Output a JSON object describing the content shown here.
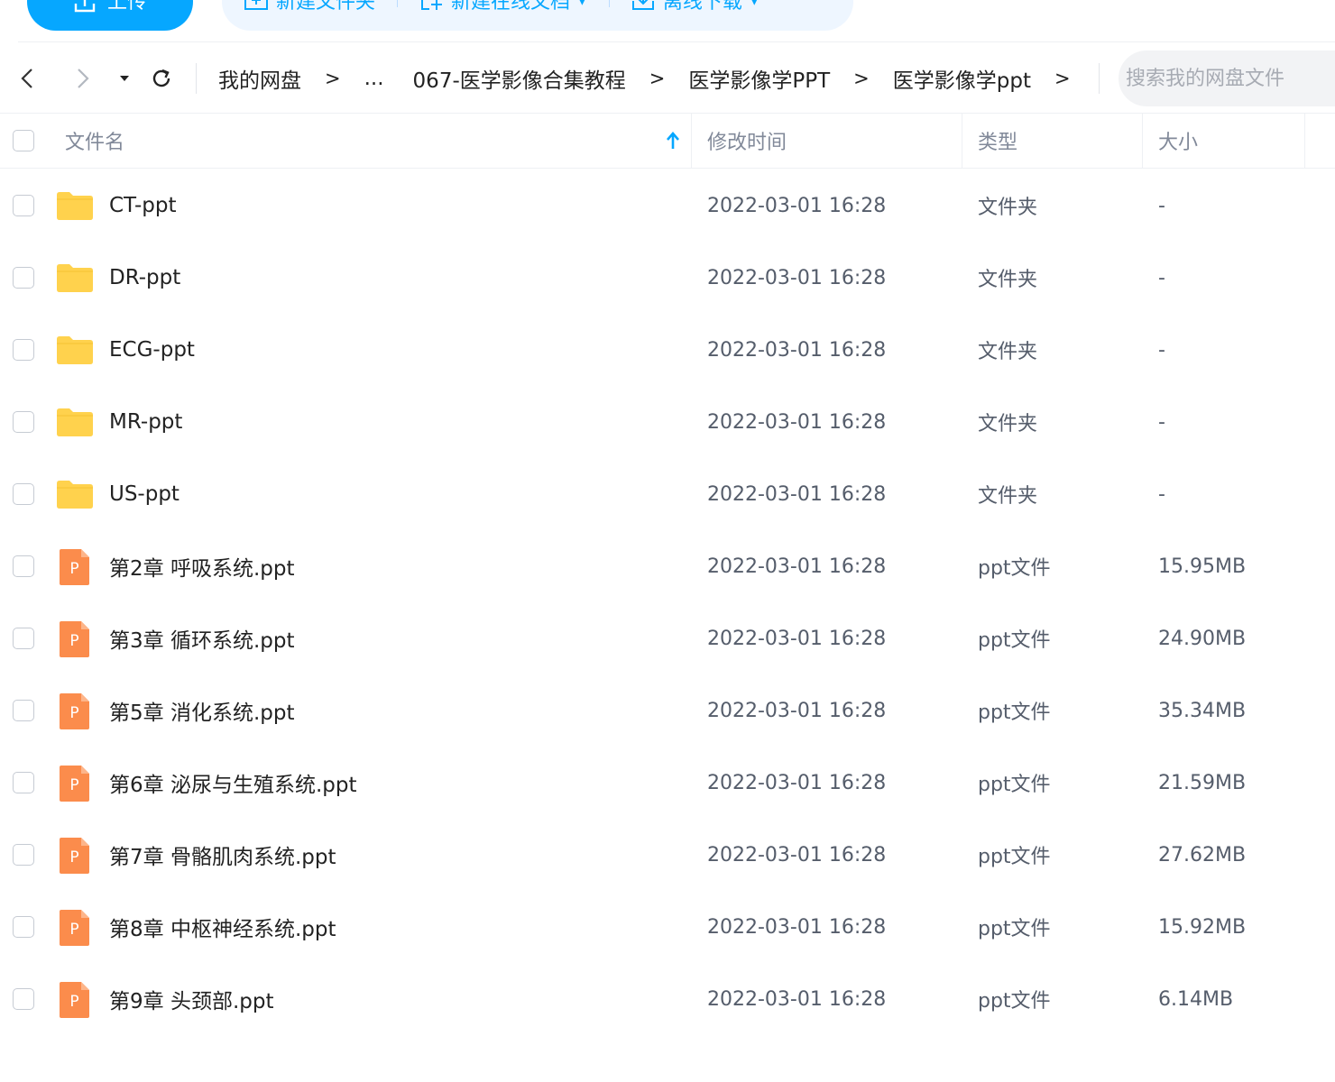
{
  "toolbar": {
    "upload_label": "上传",
    "new_folder_label": "新建文件夹",
    "new_online_doc_label": "新建在线文档",
    "offline_download_label": "离线下载"
  },
  "nav": {
    "breadcrumb": [
      "我的网盘",
      "...",
      "067-医学影像合集教程",
      "医学影像学PPT",
      "医学影像学ppt"
    ],
    "crumb_separator": ">",
    "search_placeholder": "搜索我的网盘文件"
  },
  "table": {
    "headers": {
      "name": "文件名",
      "time": "修改时间",
      "type": "类型",
      "size": "大小"
    },
    "rows": [
      {
        "name": "CT-ppt",
        "time": "2022-03-01 16:28",
        "type": "文件夹",
        "size": "-",
        "icon": "folder-icon"
      },
      {
        "name": "DR-ppt",
        "time": "2022-03-01 16:28",
        "type": "文件夹",
        "size": "-",
        "icon": "folder-icon"
      },
      {
        "name": "ECG-ppt",
        "time": "2022-03-01 16:28",
        "type": "文件夹",
        "size": "-",
        "icon": "folder-icon"
      },
      {
        "name": "MR-ppt",
        "time": "2022-03-01 16:28",
        "type": "文件夹",
        "size": "-",
        "icon": "folder-icon"
      },
      {
        "name": "US-ppt",
        "time": "2022-03-01 16:28",
        "type": "文件夹",
        "size": "-",
        "icon": "folder-icon"
      },
      {
        "name": "第2章 呼吸系统.ppt",
        "time": "2022-03-01 16:28",
        "type": "ppt文件",
        "size": "15.95MB",
        "icon": "ppt-file-icon"
      },
      {
        "name": "第3章 循环系统.ppt",
        "time": "2022-03-01 16:28",
        "type": "ppt文件",
        "size": "24.90MB",
        "icon": "ppt-file-icon"
      },
      {
        "name": "第5章 消化系统.ppt",
        "time": "2022-03-01 16:28",
        "type": "ppt文件",
        "size": "35.34MB",
        "icon": "ppt-file-icon"
      },
      {
        "name": "第6章 泌尿与生殖系统.ppt",
        "time": "2022-03-01 16:28",
        "type": "ppt文件",
        "size": "21.59MB",
        "icon": "ppt-file-icon"
      },
      {
        "name": "第7章 骨骼肌肉系统.ppt",
        "time": "2022-03-01 16:28",
        "type": "ppt文件",
        "size": "27.62MB",
        "icon": "ppt-file-icon"
      },
      {
        "name": "第8章 中枢神经系统.ppt",
        "time": "2022-03-01 16:28",
        "type": "ppt文件",
        "size": "15.92MB",
        "icon": "ppt-file-icon"
      },
      {
        "name": "第9章 头颈部.ppt",
        "time": "2022-03-01 16:28",
        "type": "ppt文件",
        "size": "6.14MB",
        "icon": "ppt-file-icon"
      }
    ]
  },
  "colors": {
    "accent": "#06a7ff",
    "folder": "#ffd24d",
    "ppt": "#fb8c4c"
  }
}
